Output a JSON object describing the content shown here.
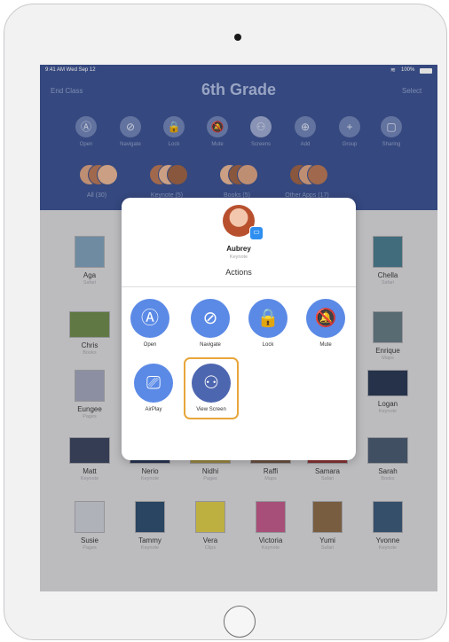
{
  "status_bar": {
    "time": "9:41 AM  Wed Sep 12",
    "battery": "100%"
  },
  "header": {
    "left_button": "End Class",
    "title": "6th Grade",
    "right_button": "Select"
  },
  "toolbar": [
    {
      "label": "Open",
      "icon": "app-store-icon",
      "glyph": "Ⓐ"
    },
    {
      "label": "Navigate",
      "icon": "compass-icon",
      "glyph": "⊘"
    },
    {
      "label": "Lock",
      "icon": "lock-icon",
      "glyph": "🔒"
    },
    {
      "label": "Mute",
      "icon": "mute-bell-icon",
      "glyph": "🔕"
    },
    {
      "label": "Screens",
      "icon": "binoculars-icon",
      "glyph": "⚇"
    },
    {
      "label": "Add",
      "icon": "add-person-icon",
      "glyph": "⊕"
    },
    {
      "label": "Group",
      "icon": "plus-icon",
      "glyph": "+"
    },
    {
      "label": "Sharing",
      "icon": "screen-share-icon",
      "glyph": "▢"
    }
  ],
  "groups": [
    {
      "label": "All (30)"
    },
    {
      "label": "Keynote (5)"
    },
    {
      "label": "Books (5)"
    },
    {
      "label": "Other Apps (17)"
    }
  ],
  "students": [
    {
      "name": "Aga",
      "app": "Safari"
    },
    {
      "name": "Chella",
      "app": "Safari"
    },
    {
      "name": "Chris",
      "app": "Books"
    },
    {
      "name": "Enrique",
      "app": "Maps"
    },
    {
      "name": "Eungee",
      "app": "Pages"
    },
    {
      "name": "Logan",
      "app": "Keynote"
    },
    {
      "name": "Matt",
      "app": "Keynote"
    },
    {
      "name": "Nerio",
      "app": "Keynote"
    },
    {
      "name": "Nidhi",
      "app": "Pages"
    },
    {
      "name": "Raffi",
      "app": "Maps"
    },
    {
      "name": "Samara",
      "app": "Safari"
    },
    {
      "name": "Sarah",
      "app": "Books"
    },
    {
      "name": "Susie",
      "app": "Pages"
    },
    {
      "name": "Tammy",
      "app": "Keynote"
    },
    {
      "name": "Vera",
      "app": "Clips"
    },
    {
      "name": "Victoria",
      "app": "Keynote"
    },
    {
      "name": "Yumi",
      "app": "Safari"
    },
    {
      "name": "Yvonne",
      "app": "Keynote"
    }
  ],
  "popup": {
    "student_name": "Aubrey",
    "student_app": "Keynote",
    "actions_title": "Actions",
    "actions": [
      {
        "label": "Open",
        "icon": "app-store-icon",
        "glyph": "Ⓐ"
      },
      {
        "label": "Navigate",
        "icon": "compass-icon",
        "glyph": "⊘"
      },
      {
        "label": "Lock",
        "icon": "lock-icon",
        "glyph": "🔒"
      },
      {
        "label": "Mute",
        "icon": "mute-bell-icon",
        "glyph": "🔕"
      },
      {
        "label": "AirPlay",
        "icon": "airplay-icon",
        "glyph": "⎚"
      },
      {
        "label": "View Screen",
        "icon": "binoculars-icon",
        "glyph": "⚇",
        "highlighted": true
      }
    ]
  },
  "colors": {
    "header_blue": "#3d5391",
    "action_blue": "#5b8ae6",
    "highlight": "#e8a63b"
  }
}
